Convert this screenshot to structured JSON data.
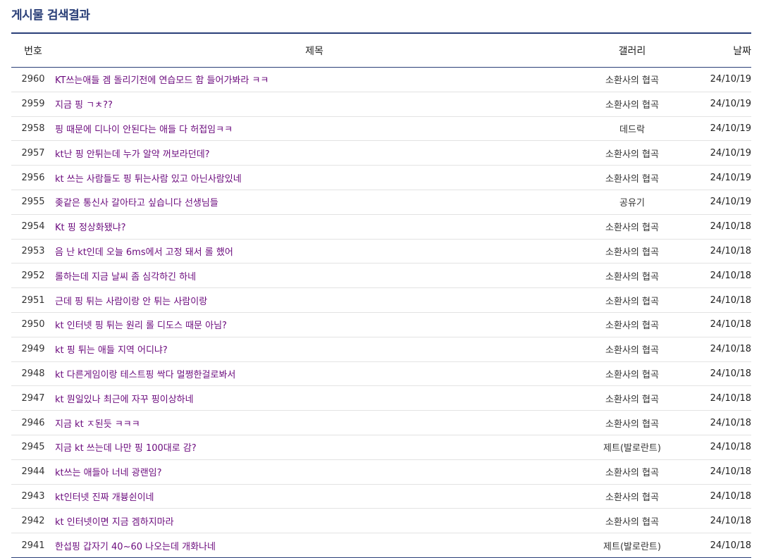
{
  "page_title": "게시물 검색결과",
  "columns": {
    "num": "번호",
    "subject": "제목",
    "gallery": "갤러리",
    "date": "날짜"
  },
  "rows": [
    {
      "num": "2960",
      "subject": "KT쓰는애들 겜 돌리기전에 연습모드 함 들어가봐라 ㅋㅋ",
      "gallery": "소환사의 협곡",
      "date": "24/10/19"
    },
    {
      "num": "2959",
      "subject": "지금 핑 ㄱㅊ??",
      "gallery": "소환사의 협곡",
      "date": "24/10/19"
    },
    {
      "num": "2958",
      "subject": "핑 때문에 디나이 안된다는 애들 다 허접임ㅋㅋ",
      "gallery": "데드락",
      "date": "24/10/19"
    },
    {
      "num": "2957",
      "subject": "kt난 핑 안튀는데 누가 알약 꺼보라던데?",
      "gallery": "소환사의 협곡",
      "date": "24/10/19"
    },
    {
      "num": "2956",
      "subject": "kt 쓰는 사람들도 핑 튀는사람 있고 아닌사람있네",
      "gallery": "소환사의 협곡",
      "date": "24/10/19"
    },
    {
      "num": "2955",
      "subject": "좆같은 통신사 갈아타고 싶습니다 선생님들",
      "gallery": "공유기",
      "date": "24/10/19"
    },
    {
      "num": "2954",
      "subject": "Kt 핑 정상화됐냐?",
      "gallery": "소환사의 협곡",
      "date": "24/10/18"
    },
    {
      "num": "2953",
      "subject": "음 난 kt인데 오늘 6ms에서 고정 돼서 롤 했어",
      "gallery": "소환사의 협곡",
      "date": "24/10/18"
    },
    {
      "num": "2952",
      "subject": "롤하는데 지금 날씨 좀 심각하긴 하네",
      "gallery": "소환사의 협곡",
      "date": "24/10/18"
    },
    {
      "num": "2951",
      "subject": "근데 핑 튀는 사람이랑 안 튀는 사람이랑",
      "gallery": "소환사의 협곡",
      "date": "24/10/18"
    },
    {
      "num": "2950",
      "subject": "kt 인터넷 핑 튀는 원리 롤 디도스 때문 아님?",
      "gallery": "소환사의 협곡",
      "date": "24/10/18"
    },
    {
      "num": "2949",
      "subject": "kt 핑 튀는 애들 지역 어디냐?",
      "gallery": "소환사의 협곡",
      "date": "24/10/18"
    },
    {
      "num": "2948",
      "subject": "kt 다른게임이랑 테스트핑 싹다 멀쩡한걸로봐서",
      "gallery": "소환사의 협곡",
      "date": "24/10/18"
    },
    {
      "num": "2947",
      "subject": "kt 뭔일있나 최근에 자꾸 핑이상하네",
      "gallery": "소환사의 협곡",
      "date": "24/10/18"
    },
    {
      "num": "2946",
      "subject": "지금 kt ㅈ된듯 ㅋㅋㅋ",
      "gallery": "소환사의 협곡",
      "date": "24/10/18"
    },
    {
      "num": "2945",
      "subject": "지금 kt 쓰는데 나만 핑 100대로 감?",
      "gallery": "제트(발로란트)",
      "date": "24/10/18"
    },
    {
      "num": "2944",
      "subject": "kt쓰는 애들아 너네 광랜임?",
      "gallery": "소환사의 협곡",
      "date": "24/10/18"
    },
    {
      "num": "2943",
      "subject": "kt인터넷 진짜 개븅쉰이네",
      "gallery": "소환사의 협곡",
      "date": "24/10/18"
    },
    {
      "num": "2942",
      "subject": "kt 인터넷이면 지금 겜하지마라",
      "gallery": "소환사의 협곡",
      "date": "24/10/18"
    },
    {
      "num": "2941",
      "subject": "한섭핑 갑자기 40~60 나오는데 개화나네",
      "gallery": "제트(발로란트)",
      "date": "24/10/18"
    }
  ]
}
